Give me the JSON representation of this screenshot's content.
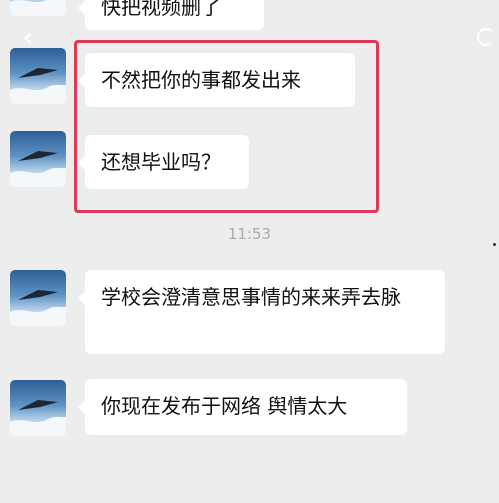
{
  "chat": {
    "top_partial_message": "快把视频删了",
    "messages_group_1": [
      {
        "text": "不然把你的事都发出来"
      },
      {
        "text": "还想毕业吗？"
      }
    ],
    "timestamp": "11:53",
    "messages_group_2": [
      {
        "text": "学校会澄清意思事情的来来弄去脉"
      },
      {
        "text": "你现在发布于网络 舆情太大"
      }
    ]
  },
  "icons": {
    "back": "back-arrow-icon",
    "right_top": "refresh-icon"
  },
  "colors": {
    "background": "#ededed",
    "bubble": "#ffffff",
    "highlight_box": "#d93b57",
    "timestamp": "#aaaaaa"
  }
}
